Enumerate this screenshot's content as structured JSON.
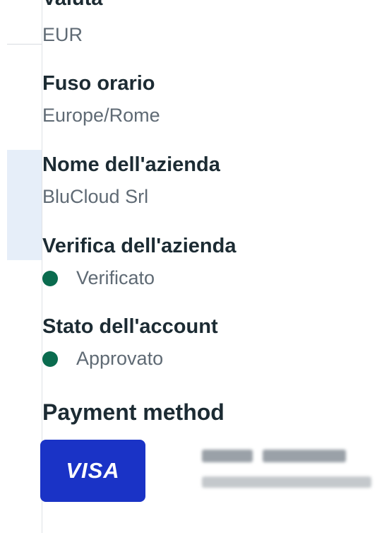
{
  "left_panel": {},
  "fields": {
    "currency": {
      "label": "Valuta",
      "value": "EUR"
    },
    "timezone": {
      "label": "Fuso orario",
      "value": "Europe/Rome"
    },
    "company_name": {
      "label": "Nome dell'azienda",
      "value": "BluCloud Srl"
    },
    "company_verification": {
      "label": "Verifica dell'azienda",
      "status": "Verificato",
      "status_color": "#0a6b4e"
    },
    "account_status": {
      "label": "Stato dell'account",
      "status": "Approvato",
      "status_color": "#0a6b4e"
    }
  },
  "payment": {
    "title": "Payment method",
    "card_brand": "VISA",
    "card_color": "#1a33c6"
  }
}
